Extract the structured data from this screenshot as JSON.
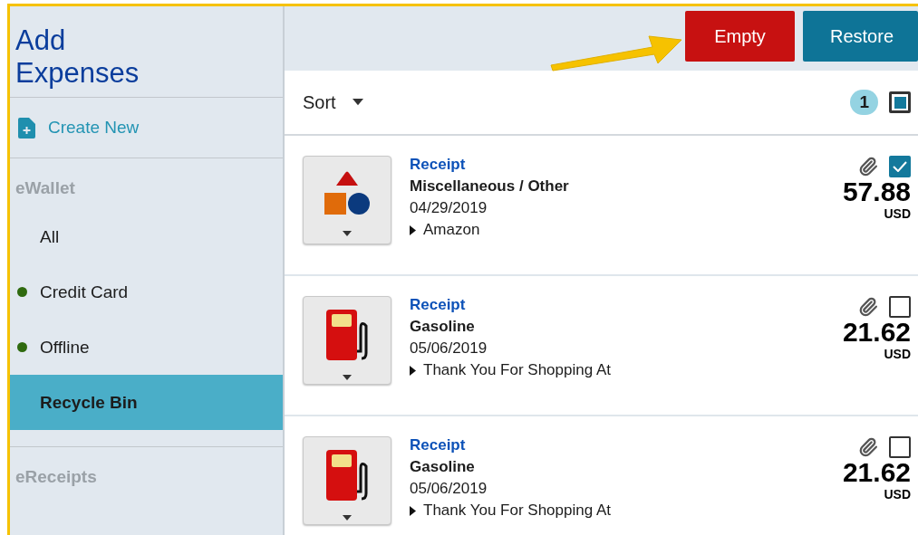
{
  "sidebar": {
    "title": "Add Expenses",
    "create": "Create New",
    "sections": [
      {
        "heading": "eWallet",
        "items": [
          {
            "label": "All",
            "selected": false
          },
          {
            "label": "Credit Card",
            "selected": false,
            "color": "#2f6a0f"
          },
          {
            "label": "Offline",
            "selected": false,
            "color": "#2f6a0f"
          },
          {
            "label": "Recycle Bin",
            "selected": true
          }
        ]
      },
      {
        "heading": "eReceipts"
      }
    ]
  },
  "toolbar": {
    "buttons": [
      {
        "label": "Empty",
        "kind": "danger"
      },
      {
        "label": "Restore",
        "kind": "primary"
      }
    ]
  },
  "list_header": {
    "sort": "Sort",
    "selected_count": "1",
    "partial": true
  },
  "expenses": [
    {
      "type": "Receipt",
      "category": "Miscellaneous / Other",
      "date": "04/29/2019",
      "merchant": "Amazon",
      "amount": "57.88",
      "currency": "USD",
      "checked": true,
      "kind": "misc"
    },
    {
      "type": "Receipt",
      "category": "Gasoline",
      "date": "05/06/2019",
      "merchant": "Thank You For Shopping At",
      "amount": "21.62",
      "currency": "USD",
      "checked": false,
      "kind": "fuel"
    },
    {
      "type": "Receipt",
      "category": "Gasoline",
      "date": "05/06/2019",
      "merchant": "Thank You For Shopping At",
      "amount": "21.62",
      "currency": "USD",
      "checked": false,
      "kind": "fuel"
    }
  ]
}
